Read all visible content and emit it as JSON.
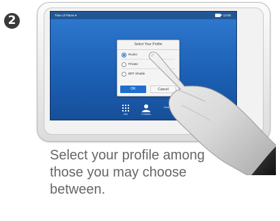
{
  "step": {
    "number": "2"
  },
  "screen": {
    "status": {
      "left": "Time of Flame ▾",
      "right": "13:00"
    },
    "dialog": {
      "title": "Select Your Profile",
      "options": [
        {
          "label": "Rooks",
          "selected": true
        },
        {
          "label": "Private",
          "selected": false
        },
        {
          "label": "BRT Shuttle",
          "selected": false
        }
      ],
      "ok_label": "OK",
      "cancel_label": "Cancel"
    },
    "tray": [
      {
        "label": "Dial",
        "icon": "keypad-icon"
      },
      {
        "label": "Contacts",
        "icon": "person-icon"
      },
      {
        "label": "Clear",
        "icon": "clear-icon"
      }
    ]
  },
  "caption": {
    "line1": "Select your profile among",
    "line2": "those you may choose",
    "line3": "between."
  },
  "colors": {
    "screen_blue": "#1b5fb3",
    "accent": "#1e6ed0",
    "caption_gray": "#666666"
  }
}
